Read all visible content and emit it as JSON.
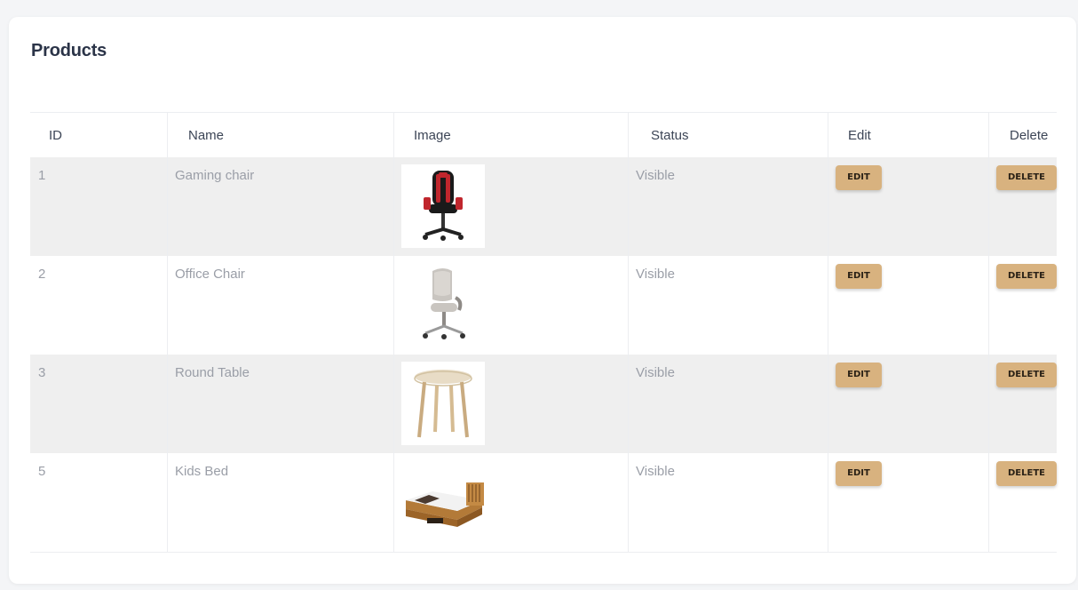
{
  "page": {
    "title": "Products"
  },
  "table": {
    "headers": {
      "id": "ID",
      "name": "Name",
      "image": "Image",
      "status": "Status",
      "edit": "Edit",
      "delete": "Delete"
    },
    "rows": [
      {
        "id": "1",
        "name": "Gaming chair",
        "image_icon": "gaming-chair-image",
        "status": "Visible",
        "edit_label": "EDIT",
        "delete_label": "DELETE"
      },
      {
        "id": "2",
        "name": "Office Chair",
        "image_icon": "office-chair-image",
        "status": "Visible",
        "edit_label": "EDIT",
        "delete_label": "DELETE"
      },
      {
        "id": "3",
        "name": "Round Table",
        "image_icon": "round-table-image",
        "status": "Visible",
        "edit_label": "EDIT",
        "delete_label": "DELETE"
      },
      {
        "id": "5",
        "name": "Kids Bed",
        "image_icon": "kids-bed-image",
        "status": "Visible",
        "edit_label": "EDIT",
        "delete_label": "DELETE"
      }
    ]
  },
  "colors": {
    "button": "#d8b27f",
    "stripe": "#efefef",
    "title": "#2b3448"
  }
}
